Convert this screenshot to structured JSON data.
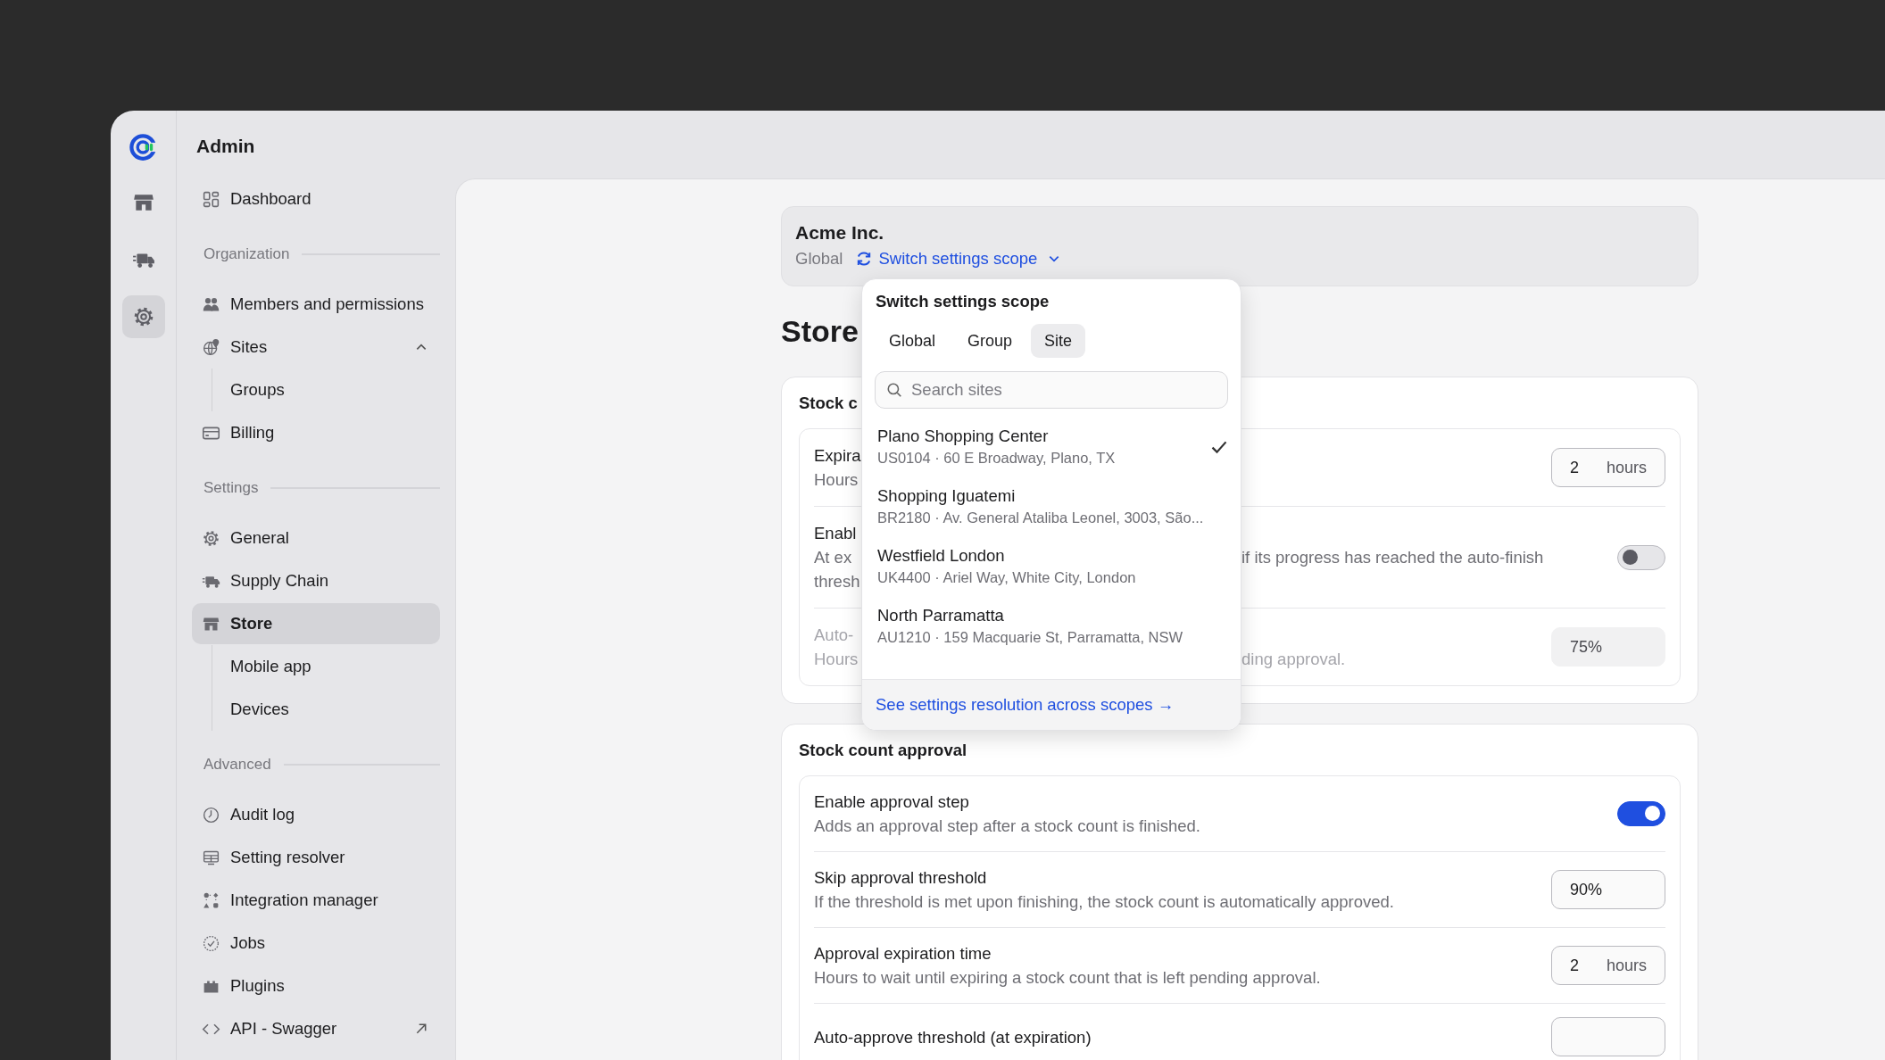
{
  "rail": {
    "items": [
      {
        "selected": false
      },
      {
        "selected": false
      },
      {
        "selected": true
      }
    ]
  },
  "sidebar": {
    "title": "Admin",
    "groups": [
      {
        "items": [
          {
            "label": "Dashboard",
            "selected": false
          }
        ]
      },
      {
        "heading": "Organization",
        "items": [
          {
            "label": "Members and permissions",
            "selected": false
          },
          {
            "label": "Sites",
            "selected": false,
            "expanded": true,
            "children": [
              {
                "label": "Groups",
                "selected": false
              }
            ]
          },
          {
            "label": "Billing",
            "selected": false
          }
        ]
      },
      {
        "heading": "Settings",
        "items": [
          {
            "label": "General",
            "selected": false
          },
          {
            "label": "Supply Chain",
            "selected": false
          },
          {
            "label": "Store",
            "selected": true,
            "children": [
              {
                "label": "Mobile app",
                "selected": false
              },
              {
                "label": "Devices",
                "selected": false
              }
            ]
          }
        ]
      },
      {
        "heading": "Advanced",
        "items": [
          {
            "label": "Audit log",
            "selected": false
          },
          {
            "label": "Setting resolver",
            "selected": false
          },
          {
            "label": "Integration manager",
            "selected": false
          },
          {
            "label": "Jobs",
            "selected": false
          },
          {
            "label": "Plugins",
            "selected": false
          },
          {
            "label": "API - Swagger",
            "selected": false,
            "external": true
          }
        ]
      }
    ]
  },
  "header": {
    "org": "Acme Inc.",
    "scope": "Global",
    "switch_link": "Switch settings scope"
  },
  "page_title": "Store",
  "scope_menu": {
    "title": "Switch settings scope",
    "tabs": [
      {
        "label": "Global",
        "selected": false
      },
      {
        "label": "Group",
        "selected": false
      },
      {
        "label": "Site",
        "selected": true
      }
    ],
    "search": {
      "placeholder": "Search sites"
    },
    "sites": [
      {
        "name": "Plano Shopping Center",
        "detail": "US0104 · 60 E Broadway, Plano, TX",
        "selected": true
      },
      {
        "name": "Shopping Iguatemi",
        "detail": "BR2180 · Av. General Ataliba Leonel, 3003, São...",
        "selected": false
      },
      {
        "name": "Westfield London",
        "detail": "UK4400 · Ariel Way, White City, London",
        "selected": false
      },
      {
        "name": "North Parramatta",
        "detail": "AU1210 · 159 Macquarie St, Parramatta, NSW",
        "selected": false
      }
    ],
    "footer_link": "See settings resolution across scopes →"
  },
  "stock_card": {
    "title": "Stock c",
    "rows": [
      {
        "kind": "hours",
        "disabled": false,
        "lines": [
          {
            "left": "Expira"
          },
          {
            "left": "Hours"
          }
        ],
        "value": "2",
        "unit": "hours"
      },
      {
        "kind": "toggle",
        "disabled": false,
        "lines": [
          {
            "left": "Enabl"
          },
          {
            "left": "At ex",
            "right": "if its progress has reached the auto-finish"
          },
          {
            "left": "thresh"
          }
        ],
        "on": false
      },
      {
        "kind": "percent",
        "disabled": true,
        "lines": [
          {
            "left": "Auto-"
          },
          {
            "left": "Hours",
            "right": "ding approval."
          }
        ],
        "value": "75%"
      }
    ]
  },
  "approval_card": {
    "title": "Stock count approval",
    "rows": [
      {
        "kind": "toggle",
        "title": "Enable approval step",
        "description": "Adds an approval step after a stock count is finished.",
        "on": true
      },
      {
        "kind": "percent",
        "title": "Skip approval threshold",
        "description": "If the threshold is met upon finishing, the stock count is automatically approved.",
        "value": "90%"
      },
      {
        "kind": "hours",
        "title": "Approval expiration time",
        "description": "Hours to wait until expiring a stock count that is left pending approval.",
        "value": "2",
        "unit": "hours"
      },
      {
        "kind": "percent",
        "title": "Auto-approve threshold (at expiration)"
      }
    ]
  }
}
